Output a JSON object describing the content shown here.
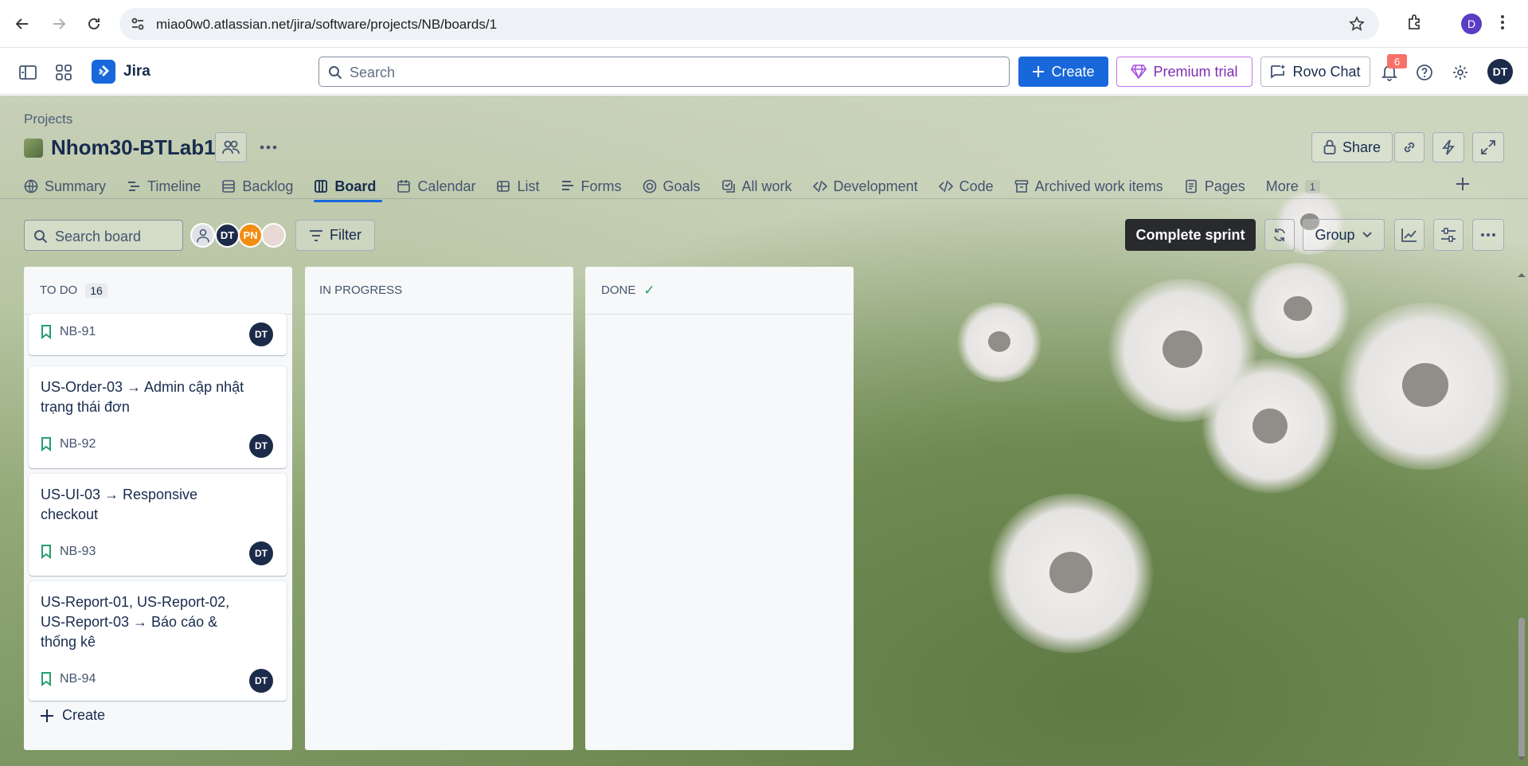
{
  "browser": {
    "url": "miao0w0.atlassian.net/jira/software/projects/NB/boards/1",
    "profile_initial": "D"
  },
  "topnav": {
    "app_name": "Jira",
    "search_placeholder": "Search",
    "create_label": "Create",
    "premium_label": "Premium trial",
    "rovo_label": "Rovo Chat",
    "notification_count": "6",
    "user_initials": "DT"
  },
  "project": {
    "breadcrumb": "Projects",
    "name": "Nhom30-BTLab1",
    "share_label": "Share"
  },
  "tabs": [
    {
      "label": "Summary",
      "icon": "globe-icon"
    },
    {
      "label": "Timeline",
      "icon": "timeline-icon"
    },
    {
      "label": "Backlog",
      "icon": "backlog-icon"
    },
    {
      "label": "Board",
      "icon": "board-icon",
      "active": true
    },
    {
      "label": "Calendar",
      "icon": "calendar-icon"
    },
    {
      "label": "List",
      "icon": "list-icon"
    },
    {
      "label": "Forms",
      "icon": "forms-icon"
    },
    {
      "label": "Goals",
      "icon": "goals-icon"
    },
    {
      "label": "All work",
      "icon": "all-work-icon"
    },
    {
      "label": "Development",
      "icon": "development-icon"
    },
    {
      "label": "Code",
      "icon": "code-icon"
    },
    {
      "label": "Archived work items",
      "icon": "archive-icon"
    },
    {
      "label": "Pages",
      "icon": "pages-icon"
    },
    {
      "label": "More",
      "count": "1"
    }
  ],
  "toolbar": {
    "search_placeholder": "Search board",
    "filter_label": "Filter",
    "complete_sprint_label": "Complete sprint",
    "group_label": "Group",
    "avatars": [
      {
        "initials": "",
        "color": "#dfe1e6"
      },
      {
        "initials": "DT",
        "color": "#1d2b4a"
      },
      {
        "initials": "PN",
        "color": "#f18d13"
      },
      {
        "initials": "",
        "color": "#e8d9d5"
      }
    ]
  },
  "columns": [
    {
      "title": "TO DO",
      "count": "16",
      "cards": [
        {
          "summary": "",
          "key": "NB-91",
          "assignee": "DT"
        },
        {
          "summary": "US-Order-03 → Admin cập nhật trạng thái đơn",
          "key": "NB-92",
          "assignee": "DT"
        },
        {
          "summary": "US-UI-03 → Responsive checkout",
          "key": "NB-93",
          "assignee": "DT"
        },
        {
          "summary": "US-Report-01, US-Report-02, US-Report-03 → Báo cáo & thống kê",
          "key": "NB-94",
          "assignee": "DT"
        }
      ],
      "create_label": "Create"
    },
    {
      "title": "IN PROGRESS",
      "cards": []
    },
    {
      "title": "DONE",
      "done_check": "✓",
      "cards": []
    }
  ],
  "colors": {
    "brand_blue": "#1868db",
    "premium_purple": "#7e2db3",
    "story_green": "#22a06b",
    "notification_red": "#f87168"
  }
}
